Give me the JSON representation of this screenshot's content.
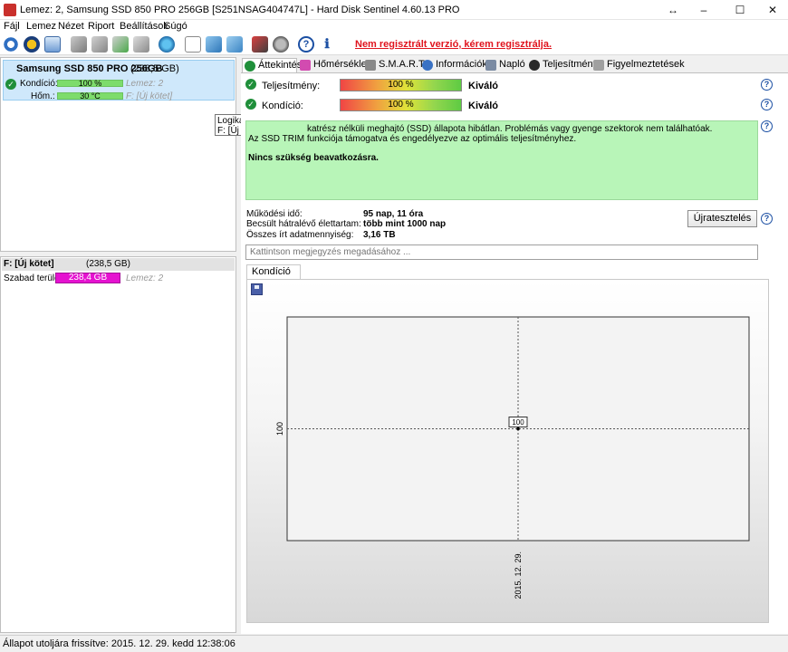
{
  "window": {
    "title": "Lemez: 2, Samsung SSD 850 PRO 256GB [S251NSAG404747L]  -  Hard Disk Sentinel 4.60.13 PRO",
    "btn_restore": "↔",
    "btn_min": "–",
    "btn_max": "☐",
    "btn_close": "✕"
  },
  "menu": [
    "Fájl",
    "Lemez",
    "Nézet",
    "Riport",
    "Beállítások",
    "Súgó"
  ],
  "toolbar": {
    "unregistered": "Nem regisztrált verzió, kérem regisztrálja.",
    "icons": [
      "refresh-icon",
      "hdd-warning-icon",
      "mail-icon",
      "disk-tool-icon",
      "disk-tool-2-icon",
      "disk-check-icon",
      "disk-settings-icon",
      "globe-icon",
      "document-icon",
      "network-icon",
      "network-2-icon",
      "monitor-icon",
      "chart-icon",
      "help-icon",
      "info-icon"
    ]
  },
  "disk": {
    "name": "Samsung SSD 850 PRO 256GB",
    "size": "(238,5 GB)",
    "kondicio_label": "Kondíció:",
    "kondicio_value": "100 %",
    "kondicio_ref": "Lemez: 2",
    "hom_label": "Hőm.:",
    "hom_value": "30 °C",
    "hom_ref": "F: [Új kötet]"
  },
  "volume": {
    "name": "F: [Új kötet]",
    "size": "(238,5 GB)",
    "free_label": "Szabad terület",
    "free_value": "238,4 GB",
    "free_ref": "Lemez: 2"
  },
  "tooltip": {
    "line1": "Logikai meghajtó(k)",
    "line2": "F: [Új kötet] NTFS"
  },
  "tabs": [
    "Áttekintés",
    "Hőmérséklet",
    "S.M.A.R.T.",
    "Információk",
    "Napló",
    "Teljesítmény",
    "Figyelmeztetések"
  ],
  "overview": {
    "teljesitmeny_label": "Teljesítmény:",
    "teljesitmeny_value": "100 %",
    "teljesitmeny_status": "Kiváló",
    "kondicio_label": "Kondíció:",
    "kondicio_value": "100 %",
    "kondicio_status": "Kiváló",
    "message_line1": "katrész nélküli meghajtó (SSD) állapota hibátlan. Problémás vagy gyenge szektorok nem találhatóak.",
    "message_line2": "Az SSD TRIM funkciója támogatva és engedélyezve az optimális teljesítményhez.",
    "message_bold": "Nincs szükség beavatkozásra.",
    "mukodesi_label": "Működési idő:",
    "mukodesi_value": "95 nap, 11 óra",
    "becsult_label": "Becsült hátralévő élettartam:",
    "becsult_value": "több mint 1000 nap",
    "osszes_label": "Összes írt adatmennyiség:",
    "osszes_value": "3,16 TB",
    "retest_button": "Újratesztelés",
    "note_placeholder": "Kattintson megjegyzés megadásához ..."
  },
  "chart_tab": {
    "label": "Kondíció  (%)"
  },
  "chart_data": {
    "type": "line",
    "title": "",
    "ylabel": "",
    "xlabel": "",
    "x": [
      "2015. 12. 29."
    ],
    "series": [
      {
        "values": [
          100
        ]
      }
    ],
    "y_tick_label": "100",
    "x_tick_label": "2015. 12. 29.",
    "point_label": "100"
  },
  "status": {
    "text": "Állapot utoljára frissítve: 2015. 12. 29. kedd 12:38:06"
  },
  "colors": {
    "accent_red": "#e0141e",
    "ok_green": "#1f8f3a",
    "box_green": "#b8f5b8",
    "magenta": "#e512d0"
  }
}
